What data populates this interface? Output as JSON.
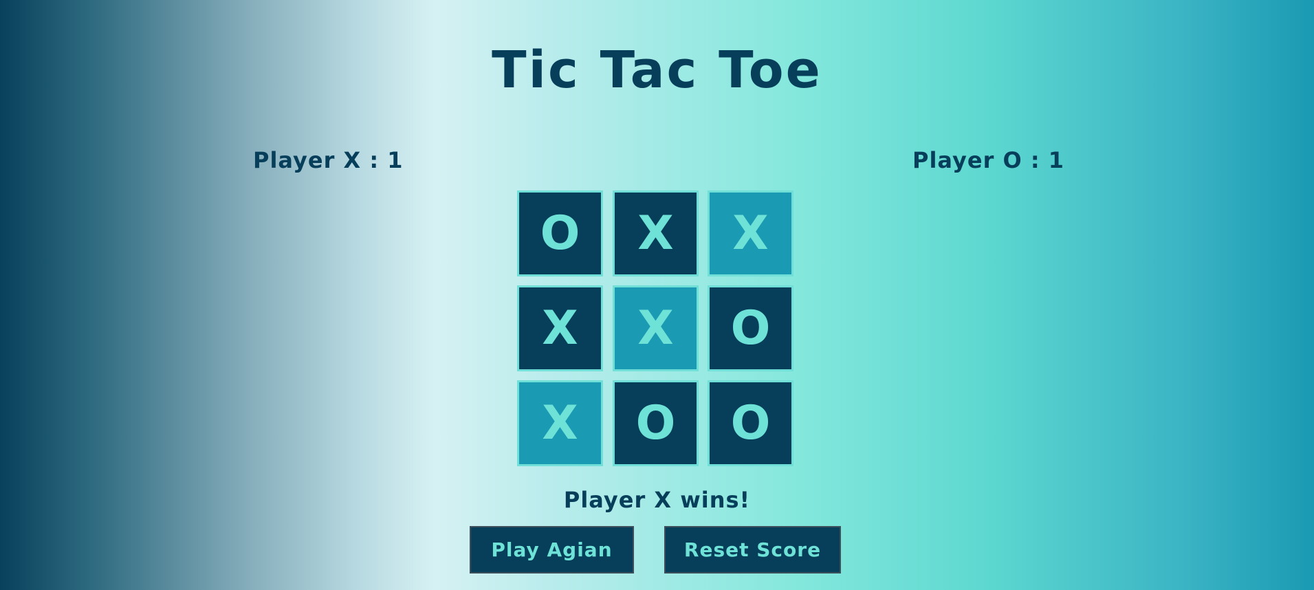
{
  "title": "Tic Tac Toe",
  "scores": {
    "player_x": "Player X : 1",
    "player_o": "Player O : 1"
  },
  "board": {
    "cells": [
      {
        "mark": "O",
        "winning": false
      },
      {
        "mark": "X",
        "winning": false
      },
      {
        "mark": "X",
        "winning": true
      },
      {
        "mark": "X",
        "winning": false
      },
      {
        "mark": "X",
        "winning": true
      },
      {
        "mark": "O",
        "winning": false
      },
      {
        "mark": "X",
        "winning": true
      },
      {
        "mark": "O",
        "winning": false
      },
      {
        "mark": "O",
        "winning": false
      }
    ]
  },
  "status": "Player X wins!",
  "buttons": {
    "play_again": "Play Agian",
    "reset_score": "Reset Score"
  },
  "colors": {
    "dark": "#073f5b",
    "accent": "#6fe2d7",
    "win_cell": "#1a9ab3"
  }
}
